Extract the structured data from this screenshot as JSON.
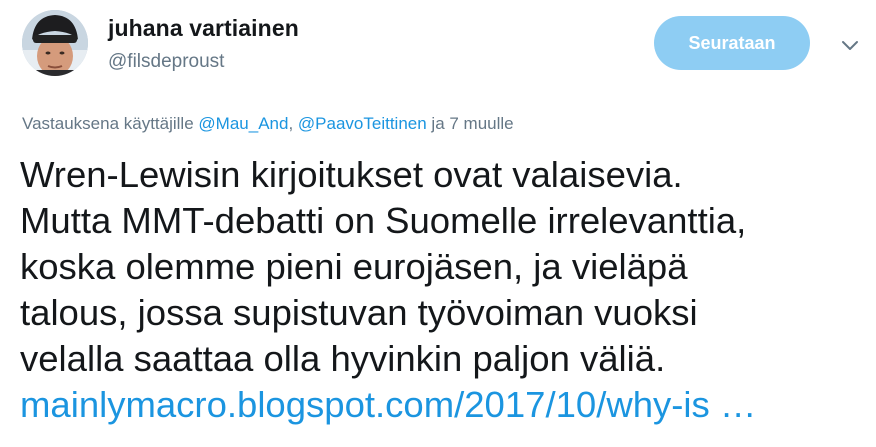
{
  "tweet": {
    "author": {
      "name": "juhana vartiainen",
      "handle": "@filsdeproust"
    },
    "follow_button_label": "Seurataan",
    "reply_context": {
      "prefix": "Vastauksena käyttäjille",
      "mention_1": "@Mau_And",
      "separator": ",",
      "mention_2": "@PaavoTeittinen",
      "suffix": "ja 7 muulle"
    },
    "text_lines": [
      "Wren-Lewisin kirjoitukset ovat valaisevia.",
      "Mutta MMT-debatti on Suomelle irrelevanttia,",
      "koska olemme pieni eurojäsen, ja vieläpä",
      "talous, jossa supistuvan työvoiman vuoksi",
      "velalla saattaa olla hyvinkin paljon väliä."
    ],
    "link_text": "mainlymacro.blogspot.com/2017/10/why-is …"
  },
  "colors": {
    "link": "#1b95e0",
    "secondary_text": "#657786",
    "primary_text": "#14171a",
    "follow_button_bg": "#8ecdf3"
  },
  "icons": {
    "caret": "chevron-down-icon",
    "avatar": "user-avatar"
  }
}
